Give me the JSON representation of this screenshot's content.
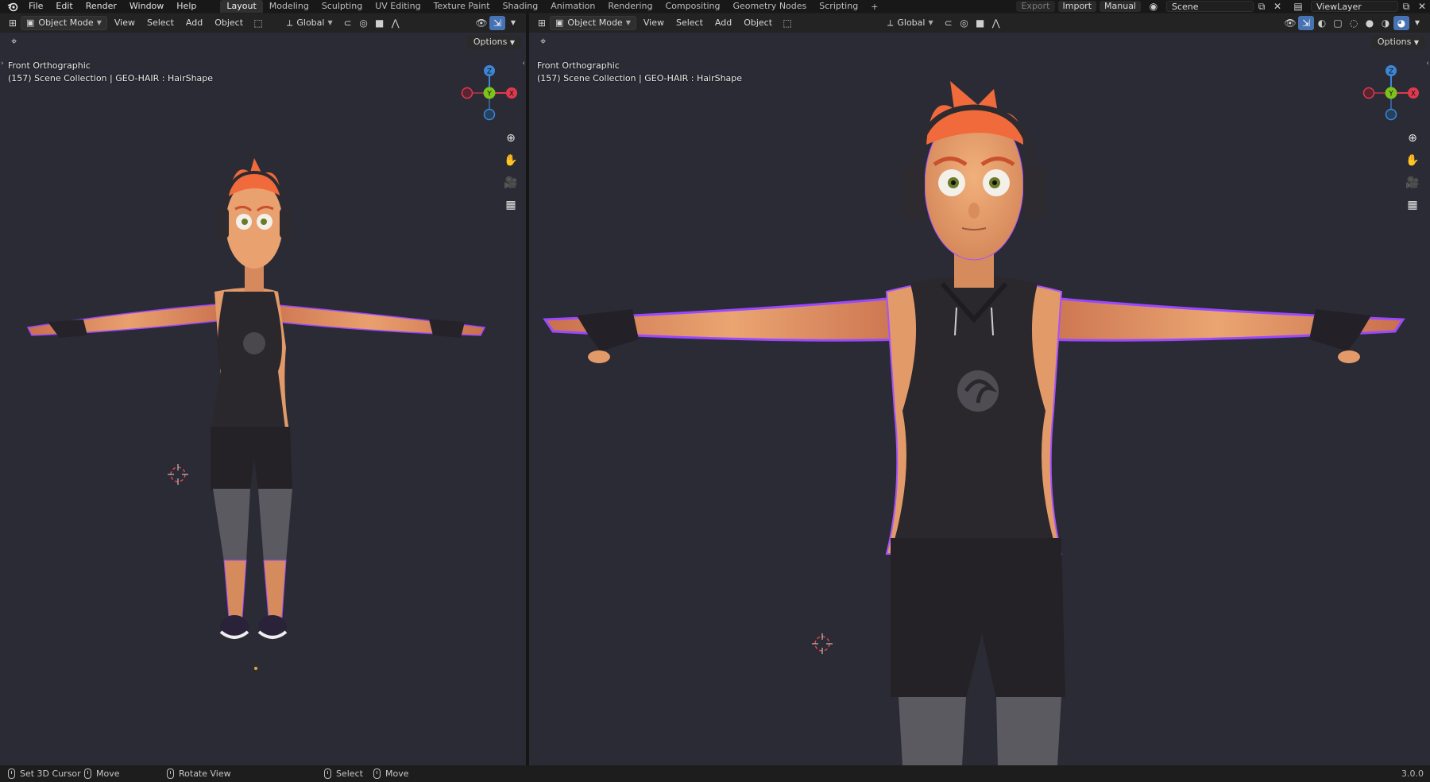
{
  "topbar": {
    "menus": [
      "File",
      "Edit",
      "Render",
      "Window",
      "Help"
    ],
    "workspaces": [
      "Layout",
      "Modeling",
      "Sculpting",
      "UV Editing",
      "Texture Paint",
      "Shading",
      "Animation",
      "Rendering",
      "Compositing",
      "Geometry Nodes",
      "Scripting"
    ],
    "active_workspace": "Layout",
    "add_workspace": "+",
    "export_label": "Export",
    "import_label": "Import",
    "manual_label": "Manual",
    "scene_name": "Scene",
    "view_layer_name": "ViewLayer"
  },
  "viewport_left": {
    "mode": "Object Mode",
    "menus": [
      "View",
      "Select",
      "Add",
      "Object"
    ],
    "orientation": "Global",
    "options_label": "Options",
    "view_name": "Front Orthographic",
    "collection_info": "(157) Scene Collection | GEO-HAIR : HairShape",
    "gizmo": {
      "z": "Z",
      "y": "Y",
      "x": "X"
    }
  },
  "viewport_right": {
    "mode": "Object Mode",
    "menus": [
      "View",
      "Select",
      "Add",
      "Object"
    ],
    "orientation": "Global",
    "options_label": "Options",
    "view_name": "Front Orthographic",
    "collection_info": "(157) Scene Collection | GEO-HAIR : HairShape",
    "gizmo": {
      "z": "Z",
      "y": "Y",
      "x": "X"
    }
  },
  "statusbar": {
    "items": [
      "Set 3D Cursor",
      "Move",
      "Rotate View",
      "Select",
      "Move"
    ],
    "version": "3.0.0"
  },
  "colors": {
    "viewport_bg": "#2b2b35",
    "accent_blue": "#4772b3",
    "axis_x": "#e0394f",
    "axis_y": "#7cc31a",
    "axis_z": "#3d86d6",
    "skin": "#e59a67",
    "hair": "#f06a3c",
    "rim_light": "#a552ff"
  },
  "icons": [
    "blender-logo-icon",
    "editor-type-icon",
    "object-mode-icon",
    "transform-pivot-icon",
    "snap-icon",
    "proportional-edit-icon",
    "visibility-icon",
    "gizmo-icon",
    "overlay-icon",
    "xray-icon",
    "shading-wireframe-icon",
    "shading-solid-icon",
    "shading-material-icon",
    "shading-rendered-icon",
    "zoom-icon",
    "pan-hand-icon",
    "camera-icon",
    "grid-ortho-icon",
    "select-box-icon",
    "mouse-icon"
  ]
}
